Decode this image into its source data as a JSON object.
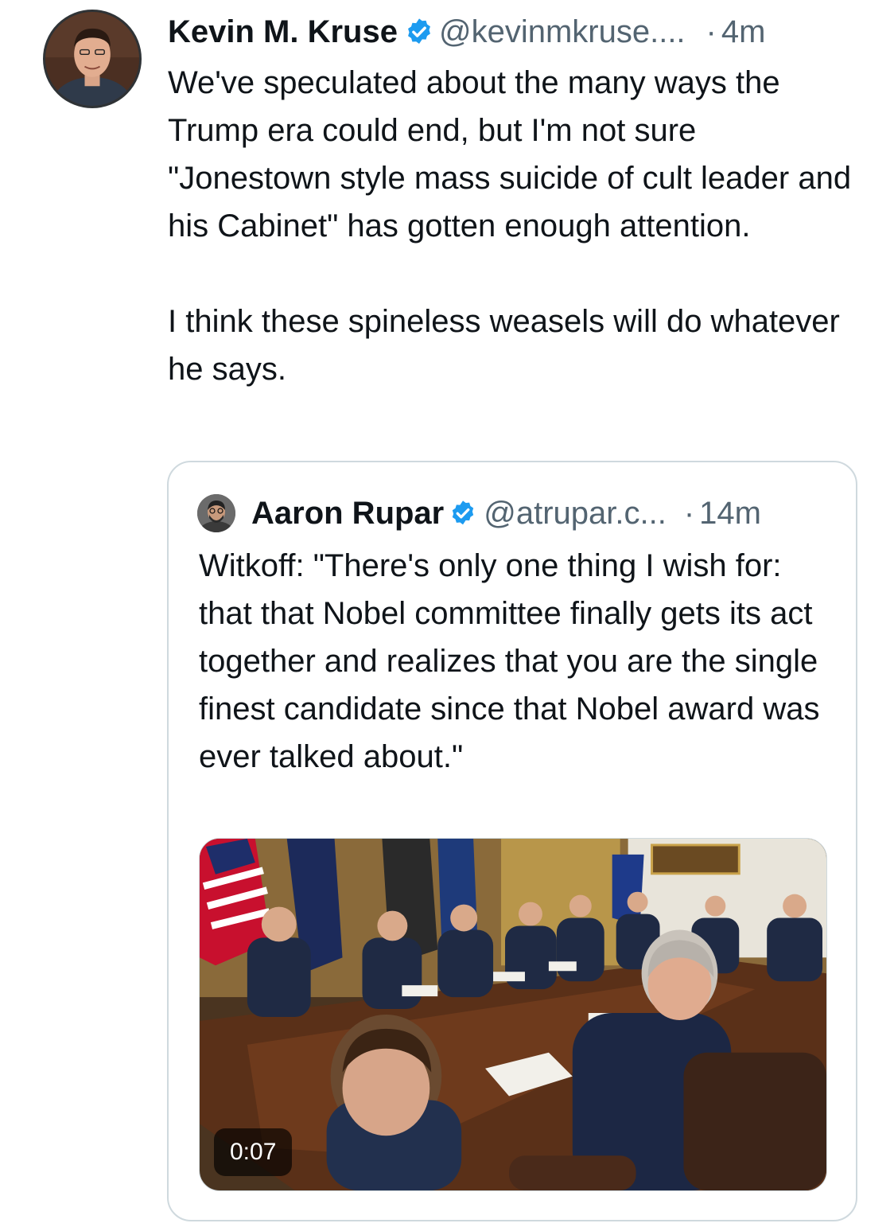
{
  "colors": {
    "text_primary": "#0f1419",
    "text_secondary": "#536471",
    "verified_blue": "#1d9bf0",
    "border": "#cfd9de"
  },
  "tweet": {
    "author_name": "Kevin M. Kruse",
    "handle": "@kevinmkruse....",
    "separator": "·",
    "time": "4m",
    "avatar_icon": "profile-photo",
    "verified_icon": "verified-badge-icon",
    "text_paragraph_1": "We've speculated about the many ways the Trump era could end, but I'm not sure \"Jonestown style mass suicide of cult leader and his Cabinet\" has gotten enough attention.",
    "text_paragraph_2": "I think these spineless weasels will do whatever he says."
  },
  "quoted_tweet": {
    "author_name": "Aaron Rupar",
    "handle": "@atrupar.c...",
    "separator": "·",
    "time": "14m",
    "avatar_icon": "profile-photo",
    "verified_icon": "verified-badge-icon",
    "text": "Witkoff: \"There's only one thing I wish for: that that Nobel committee finally gets its act together and realizes that you are the single finest candidate since that Nobel award was ever talked about.\"",
    "media": {
      "type": "video",
      "duration": "0:07"
    }
  }
}
